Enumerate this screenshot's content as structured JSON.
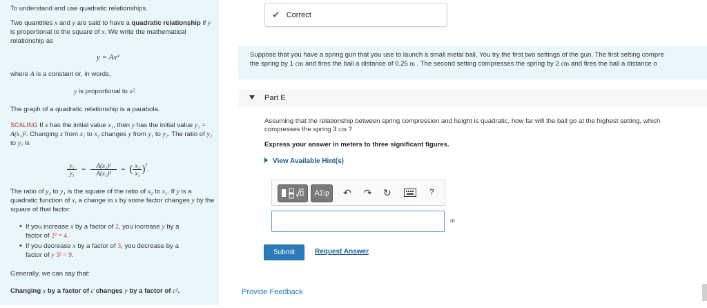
{
  "left": {
    "intro": "To understand and use quadratic relationships.",
    "def_a": "Two quantities",
    "def_x": "x",
    "def_and": "and",
    "def_y": "y",
    "def_b": "are said to have a",
    "def_bold": "quadratic relationship",
    "def_c": "if",
    "def_d": "is proportional to the square of",
    "def_e": ". We write the mathematical relationship as",
    "formula": "y = Ax²",
    "where": "where",
    "where_A": "A",
    "where_rest": "is a constant or, in words,",
    "prop_text": "is proportional to",
    "prop_math": "x².",
    "parabola": "The graph of a quadratic relationship is a parabola.",
    "scaling_label": "SCALING",
    "scaling_1": "If",
    "scaling_2": "has the initial value",
    "scaling_x1": "x₁",
    "scaling_3": ", then",
    "scaling_4": "has the initial value",
    "scaling_y1": "y₁ = A(x₁)²",
    "scaling_5": ". Changing",
    "scaling_6": "from",
    "scaling_7": "to",
    "scaling_x2": "x₂",
    "scaling_8": "changes",
    "scaling_9": "from",
    "scaling_y1b": "y₁",
    "scaling_10": "to",
    "scaling_y2": "y₂",
    "scaling_11": ". The ratio of",
    "scaling_12": "to",
    "scaling_13": "is",
    "ratio_lhs_num": "y₂",
    "ratio_lhs_den": "y₁",
    "ratio_mid_num": "A(x₂)²",
    "ratio_mid_den": "A(x₁)²",
    "ratio_rhs_num": "x₂",
    "ratio_rhs_den": "x₁",
    "ratio_exp": "²",
    "ratio_line_1": "The ratio of",
    "ratio_line_2": "to",
    "ratio_line_3": "is the square of the ratio of",
    "ratio_line_4": "to",
    "ratio_line_5": ". If",
    "ratio_line_6": "is a quadratic function of",
    "ratio_line_7": ", a change in",
    "ratio_line_8": "by some factor changes",
    "ratio_line_9": "by the square of that factor:",
    "bullet1_a": "If you increase",
    "bullet1_b": "by a factor of",
    "bullet1_factor": "2",
    "bullet1_c": ", you increase",
    "bullet1_d": "by a factor of",
    "bullet1_val": "2² = 4",
    "bullet2_a": "If you decrease",
    "bullet2_b": "by a factor of",
    "bullet2_factor": "3",
    "bullet2_c": ", you decrease",
    "bullet2_d": "by a factor of",
    "bullet2_val": "3² = 9",
    "generally": "Generally, we can say that:",
    "final_a": "Changing",
    "final_b": "by a factor of",
    "final_c": "c",
    "final_d": "changes",
    "final_e": "by a factor of",
    "final_f": "c²"
  },
  "status": {
    "label": "Correct"
  },
  "setup": {
    "line1": "Suppose that you have a spring gun that you use to launch a small metal ball. You try the first two settings of the gun. The first setting compre",
    "line2a": "the spring by 1",
    "line2_cm": "cm",
    "line2b": "and fires the ball a distance of 0.25",
    "line2_m": "m",
    "line2c": ". The second setting compresses the spring by 2",
    "line2_cm2": "cm",
    "line2d": "and fires the ball a distance o"
  },
  "part": {
    "label": "Part E"
  },
  "question": {
    "line1": "Assuming that the relationship between spring compression and height is quadratic, how far will the ball go at the highest setting, which",
    "line2a": "compresses the spring 3",
    "line2_cm": "cm",
    "line2b": "?"
  },
  "express": "Express your answer in meters to three significant figures.",
  "hint": {
    "label": "View Available Hint(s)"
  },
  "toolbar": {
    "greek_label": "ΑΣφ",
    "help_label": "?"
  },
  "answer": {
    "value": "",
    "unit": "m"
  },
  "actions": {
    "submit_label": "Submit",
    "request_label": "Request Answer"
  },
  "feedback": {
    "label": "Provide Feedback"
  }
}
